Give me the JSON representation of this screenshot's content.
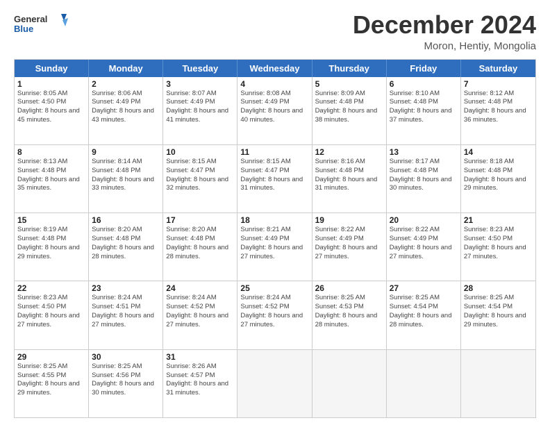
{
  "logo": {
    "line1": "General",
    "line2": "Blue"
  },
  "title": "December 2024",
  "location": "Moron, Hentiy, Mongolia",
  "weekdays": [
    "Sunday",
    "Monday",
    "Tuesday",
    "Wednesday",
    "Thursday",
    "Friday",
    "Saturday"
  ],
  "weeks": [
    [
      {
        "day": "1",
        "sunrise": "8:05 AM",
        "sunset": "4:50 PM",
        "daylight": "8 hours and 45 minutes."
      },
      {
        "day": "2",
        "sunrise": "8:06 AM",
        "sunset": "4:49 PM",
        "daylight": "8 hours and 43 minutes."
      },
      {
        "day": "3",
        "sunrise": "8:07 AM",
        "sunset": "4:49 PM",
        "daylight": "8 hours and 41 minutes."
      },
      {
        "day": "4",
        "sunrise": "8:08 AM",
        "sunset": "4:49 PM",
        "daylight": "8 hours and 40 minutes."
      },
      {
        "day": "5",
        "sunrise": "8:09 AM",
        "sunset": "4:48 PM",
        "daylight": "8 hours and 38 minutes."
      },
      {
        "day": "6",
        "sunrise": "8:10 AM",
        "sunset": "4:48 PM",
        "daylight": "8 hours and 37 minutes."
      },
      {
        "day": "7",
        "sunrise": "8:12 AM",
        "sunset": "4:48 PM",
        "daylight": "8 hours and 36 minutes."
      }
    ],
    [
      {
        "day": "8",
        "sunrise": "8:13 AM",
        "sunset": "4:48 PM",
        "daylight": "8 hours and 35 minutes."
      },
      {
        "day": "9",
        "sunrise": "8:14 AM",
        "sunset": "4:48 PM",
        "daylight": "8 hours and 33 minutes."
      },
      {
        "day": "10",
        "sunrise": "8:15 AM",
        "sunset": "4:47 PM",
        "daylight": "8 hours and 32 minutes."
      },
      {
        "day": "11",
        "sunrise": "8:15 AM",
        "sunset": "4:47 PM",
        "daylight": "8 hours and 31 minutes."
      },
      {
        "day": "12",
        "sunrise": "8:16 AM",
        "sunset": "4:48 PM",
        "daylight": "8 hours and 31 minutes."
      },
      {
        "day": "13",
        "sunrise": "8:17 AM",
        "sunset": "4:48 PM",
        "daylight": "8 hours and 30 minutes."
      },
      {
        "day": "14",
        "sunrise": "8:18 AM",
        "sunset": "4:48 PM",
        "daylight": "8 hours and 29 minutes."
      }
    ],
    [
      {
        "day": "15",
        "sunrise": "8:19 AM",
        "sunset": "4:48 PM",
        "daylight": "8 hours and 29 minutes."
      },
      {
        "day": "16",
        "sunrise": "8:20 AM",
        "sunset": "4:48 PM",
        "daylight": "8 hours and 28 minutes."
      },
      {
        "day": "17",
        "sunrise": "8:20 AM",
        "sunset": "4:48 PM",
        "daylight": "8 hours and 28 minutes."
      },
      {
        "day": "18",
        "sunrise": "8:21 AM",
        "sunset": "4:49 PM",
        "daylight": "8 hours and 27 minutes."
      },
      {
        "day": "19",
        "sunrise": "8:22 AM",
        "sunset": "4:49 PM",
        "daylight": "8 hours and 27 minutes."
      },
      {
        "day": "20",
        "sunrise": "8:22 AM",
        "sunset": "4:49 PM",
        "daylight": "8 hours and 27 minutes."
      },
      {
        "day": "21",
        "sunrise": "8:23 AM",
        "sunset": "4:50 PM",
        "daylight": "8 hours and 27 minutes."
      }
    ],
    [
      {
        "day": "22",
        "sunrise": "8:23 AM",
        "sunset": "4:50 PM",
        "daylight": "8 hours and 27 minutes."
      },
      {
        "day": "23",
        "sunrise": "8:24 AM",
        "sunset": "4:51 PM",
        "daylight": "8 hours and 27 minutes."
      },
      {
        "day": "24",
        "sunrise": "8:24 AM",
        "sunset": "4:52 PM",
        "daylight": "8 hours and 27 minutes."
      },
      {
        "day": "25",
        "sunrise": "8:24 AM",
        "sunset": "4:52 PM",
        "daylight": "8 hours and 27 minutes."
      },
      {
        "day": "26",
        "sunrise": "8:25 AM",
        "sunset": "4:53 PM",
        "daylight": "8 hours and 28 minutes."
      },
      {
        "day": "27",
        "sunrise": "8:25 AM",
        "sunset": "4:54 PM",
        "daylight": "8 hours and 28 minutes."
      },
      {
        "day": "28",
        "sunrise": "8:25 AM",
        "sunset": "4:54 PM",
        "daylight": "8 hours and 29 minutes."
      }
    ],
    [
      {
        "day": "29",
        "sunrise": "8:25 AM",
        "sunset": "4:55 PM",
        "daylight": "8 hours and 29 minutes."
      },
      {
        "day": "30",
        "sunrise": "8:25 AM",
        "sunset": "4:56 PM",
        "daylight": "8 hours and 30 minutes."
      },
      {
        "day": "31",
        "sunrise": "8:26 AM",
        "sunset": "4:57 PM",
        "daylight": "8 hours and 31 minutes."
      },
      null,
      null,
      null,
      null
    ]
  ]
}
